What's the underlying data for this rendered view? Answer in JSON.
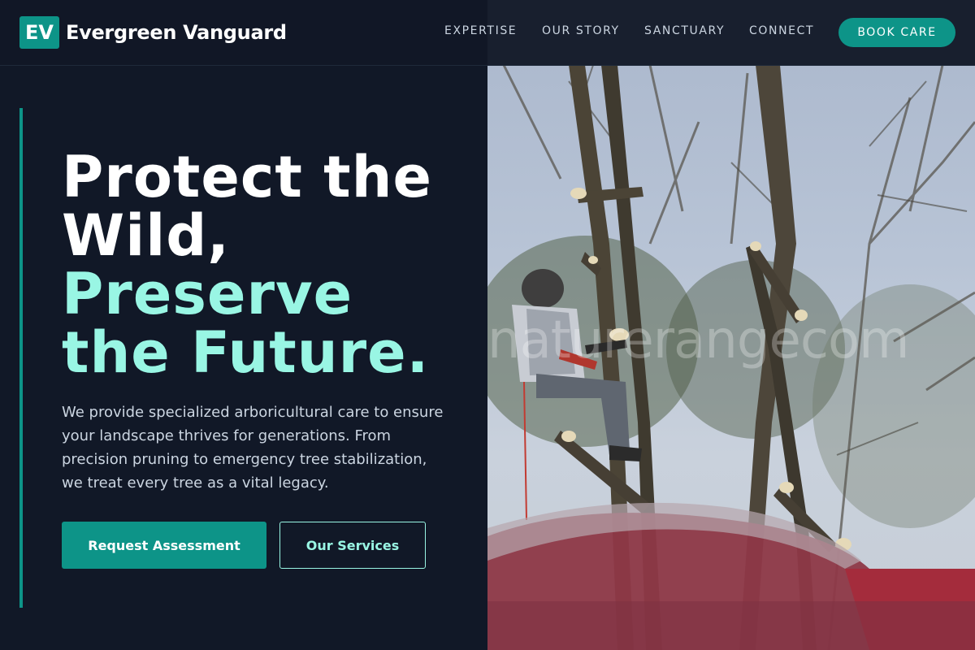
{
  "brand": {
    "badge": "EV",
    "name": "Evergreen Vanguard",
    "accent_color": "#0d9488",
    "highlight_color": "#99f6e4"
  },
  "nav": {
    "items": [
      "EXPERTISE",
      "OUR STORY",
      "SANCTUARY",
      "CONNECT"
    ],
    "cta": "BOOK CARE"
  },
  "hero": {
    "headline_line1": "Protect the",
    "headline_line2": "Wild,",
    "headline_line3": "Preserve",
    "headline_line4": "the Future.",
    "description": "We provide specialized arboricultural care to ensure your landscape thrives for generations. From precision pruning to emergency tree stabilization, we treat every tree as a vital legacy.",
    "primary_button": "Request Assessment",
    "secondary_button": "Our Services"
  },
  "photo": {
    "watermark": "naturerangecom"
  }
}
